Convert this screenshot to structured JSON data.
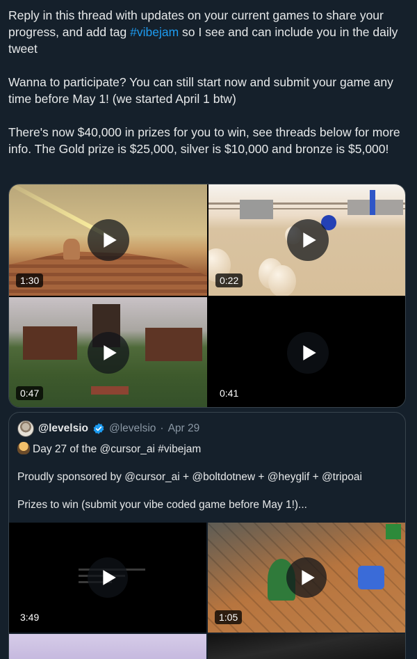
{
  "post": {
    "para1": {
      "before": "Reply in this thread with updates on your current games to share your progress, and add tag ",
      "hashtag": "#vibejam",
      "after": " so I see and can include you in the daily tweet"
    },
    "para2": "Wanna to participate? You can still start now and submit your game any time before May 1! (we started April 1 btw)",
    "para3": "There's now $40,000 in prizes for you to win, see threads below for more info. The Gold prize is $25,000, silver is $10,000 and bronze is $5,000!"
  },
  "media": {
    "videos": [
      {
        "duration": "1:30"
      },
      {
        "duration": "0:22"
      },
      {
        "duration": "0:47"
      },
      {
        "duration": "0:41"
      }
    ]
  },
  "quote": {
    "display_name": "@levelsio",
    "handle": "@levelsio",
    "separator": "·",
    "date": "Apr 29",
    "line1": "Day 27 of the @cursor_ai #vibejam",
    "line2": "Proudly sponsored by @cursor_ai + @boltdotnew + @heyglif + @tripoai",
    "line3": "Prizes to win (submit your vibe coded game before May 1!)...",
    "videos": [
      {
        "duration": "3:49"
      },
      {
        "duration": "1:05"
      }
    ]
  },
  "colors": {
    "background": "#15202b",
    "text": "#e7e9ea",
    "secondary": "#8b98a5",
    "link": "#1d9bf0",
    "border": "#38444d"
  }
}
